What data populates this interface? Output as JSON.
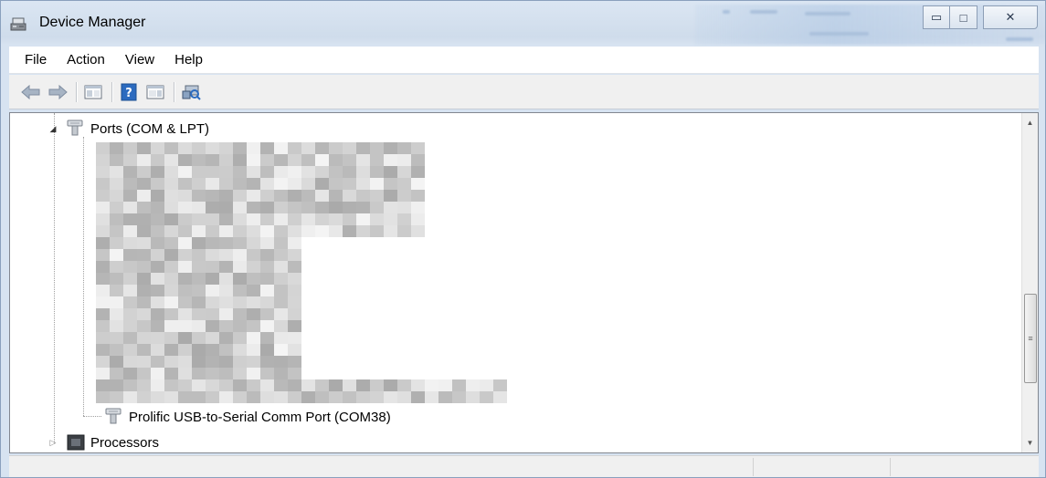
{
  "window": {
    "title": "Device Manager",
    "caption_buttons": {
      "minimize": "▭",
      "maximize": "□",
      "close": "✕"
    }
  },
  "menu": {
    "items": [
      "File",
      "Action",
      "View",
      "Help"
    ]
  },
  "toolbar": {
    "buttons": [
      "back-arrow-icon",
      "forward-arrow-icon",
      "show-hide-console-tree-icon",
      "help-icon",
      "show-hide-action-pane-icon",
      "scan-hardware-changes-icon"
    ]
  },
  "tree": {
    "ports": {
      "label": "Ports (COM & LPT)",
      "expander": "◢"
    },
    "redacted_note": "",
    "prolific": {
      "label": "Prolific USB-to-Serial Comm Port (COM38)"
    },
    "processors": {
      "label": "Processors",
      "expander": "▷"
    }
  },
  "scrollbar": {
    "up": "▲",
    "down": "▼",
    "grip": "≡"
  },
  "colors": {
    "accent": "#2c6bbf",
    "window_frame": "#cfdceb",
    "redaction_gray": "#b9b9b9"
  }
}
